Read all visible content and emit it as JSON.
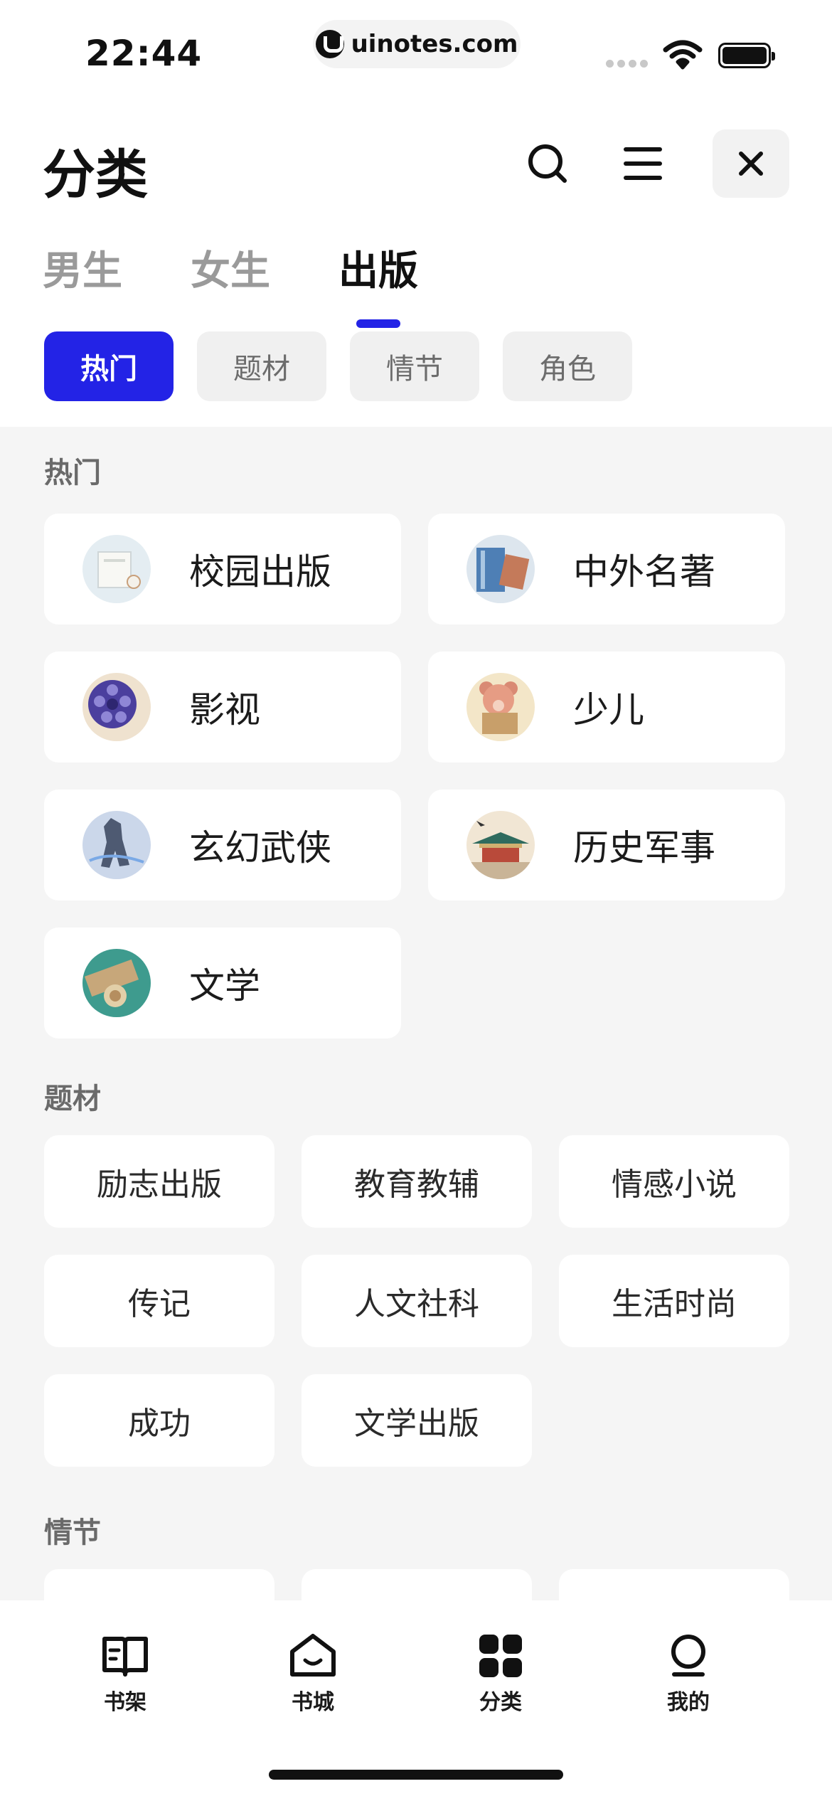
{
  "status_bar": {
    "time": "22:44",
    "site": "uinotes.com"
  },
  "header": {
    "title": "分类"
  },
  "gender_tabs": [
    {
      "label": "男生",
      "active": false
    },
    {
      "label": "女生",
      "active": false
    },
    {
      "label": "出版",
      "active": true
    }
  ],
  "chips": [
    {
      "label": "热门",
      "active": true
    },
    {
      "label": "题材",
      "active": false
    },
    {
      "label": "情节",
      "active": false
    },
    {
      "label": "角色",
      "active": false
    }
  ],
  "sections": {
    "hot": {
      "title": "热门",
      "items": [
        {
          "label": "校园出版",
          "icon": "campus-thumb"
        },
        {
          "label": "中外名著",
          "icon": "classics-thumb"
        },
        {
          "label": "影视",
          "icon": "film-reel-thumb"
        },
        {
          "label": "少儿",
          "icon": "teddy-bear-thumb"
        },
        {
          "label": "玄幻武侠",
          "icon": "warrior-thumb"
        },
        {
          "label": "历史军事",
          "icon": "palace-thumb"
        },
        {
          "label": "文学",
          "icon": "scroll-thumb"
        }
      ]
    },
    "theme": {
      "title": "题材",
      "items": [
        "励志出版",
        "教育教辅",
        "情感小说",
        "传记",
        "人文社科",
        "生活时尚",
        "成功",
        "文学出版"
      ]
    },
    "plot": {
      "title": "情节"
    }
  },
  "bottom_nav": [
    {
      "label": "书架",
      "icon": "bookshelf-icon"
    },
    {
      "label": "书城",
      "icon": "bookstore-icon"
    },
    {
      "label": "分类",
      "icon": "category-icon"
    },
    {
      "label": "我的",
      "icon": "profile-icon"
    }
  ],
  "colors": {
    "accent": "#2323e6",
    "background": "#f5f5f5",
    "card": "#ffffff"
  }
}
